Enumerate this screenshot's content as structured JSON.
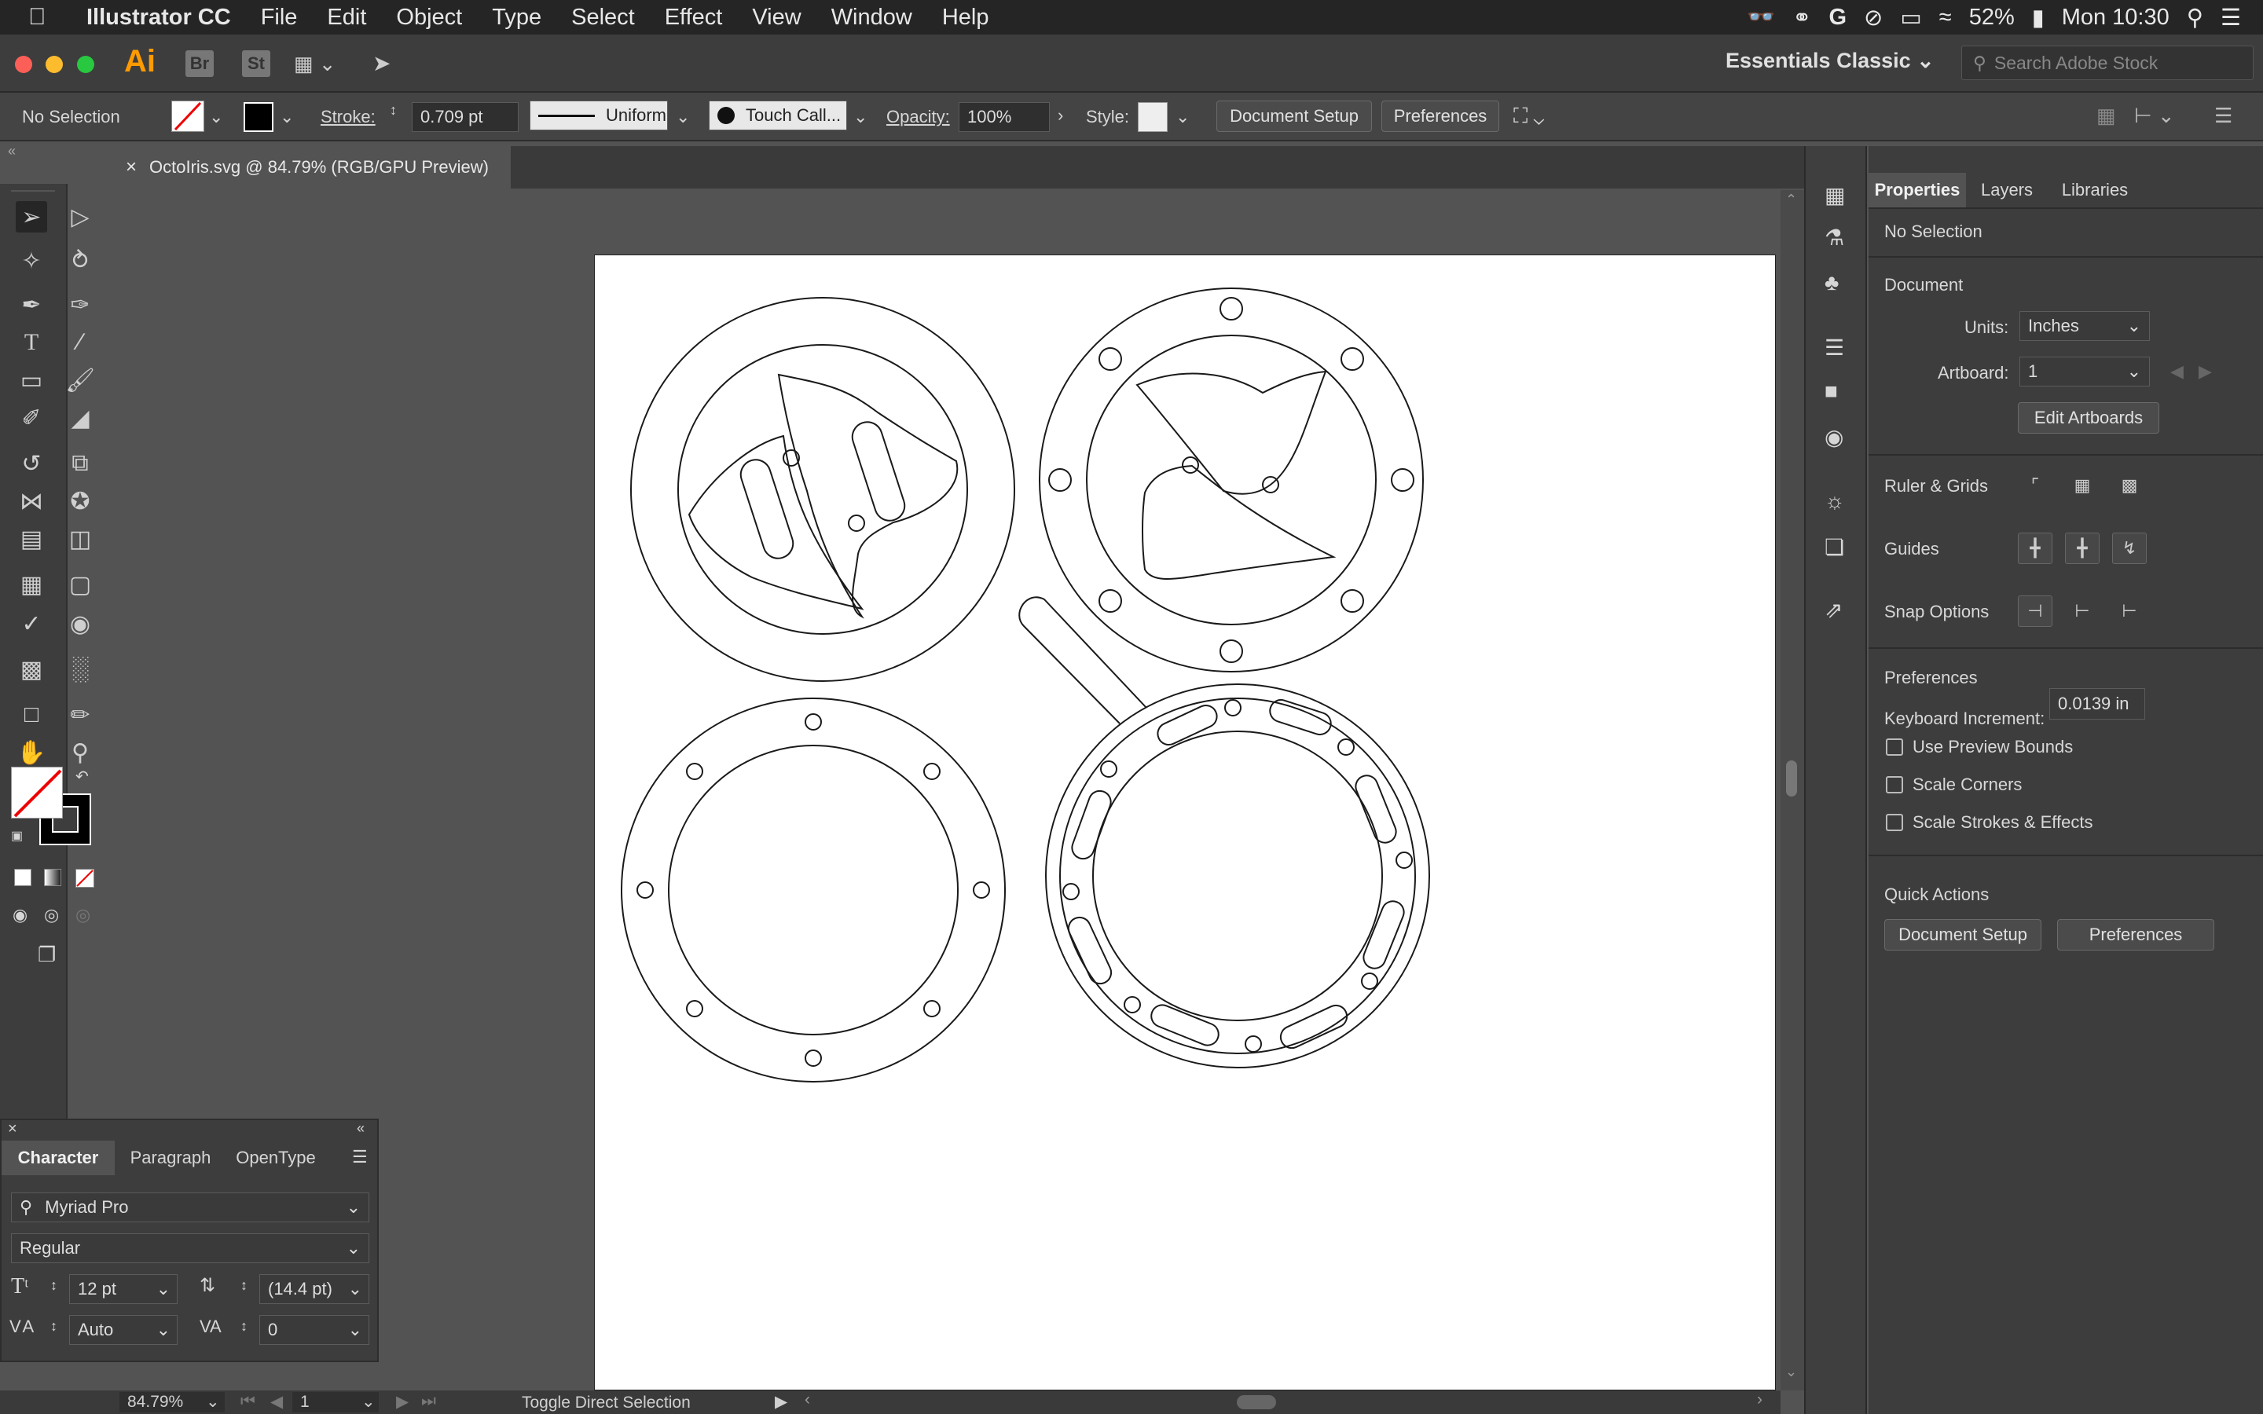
{
  "menubar": {
    "app_name": "Illustrator CC",
    "items": [
      "File",
      "Edit",
      "Object",
      "Type",
      "Select",
      "Effect",
      "View",
      "Window",
      "Help"
    ],
    "battery": "52%",
    "clock": "Mon 10:30"
  },
  "appbar": {
    "ai_logo": "Ai",
    "br_label": "Br",
    "st_label": "St",
    "workspace": "Essentials Classic",
    "search_placeholder": "Search Adobe Stock"
  },
  "control": {
    "selection_status": "No Selection",
    "stroke_label": "Stroke:",
    "stroke_value": "0.709 pt",
    "profile": "Uniform",
    "brush": "Touch Call...",
    "opacity_label": "Opacity:",
    "opacity_value": "100%",
    "style_label": "Style:",
    "doc_setup": "Document Setup",
    "preferences": "Preferences"
  },
  "document": {
    "tab_title": "OctoIris.svg @ 84.79% (RGB/GPU Preview)"
  },
  "properties": {
    "tabs": [
      "Properties",
      "Layers",
      "Libraries"
    ],
    "selection": "No Selection",
    "document_heading": "Document",
    "units_label": "Units:",
    "units_value": "Inches",
    "artboard_label": "Artboard:",
    "artboard_value": "1",
    "edit_artboards": "Edit Artboards",
    "ruler_grids": "Ruler & Grids",
    "guides": "Guides",
    "snap_options": "Snap Options",
    "prefs_heading": "Preferences",
    "keyboard_increment_label": "Keyboard Increment:",
    "keyboard_increment_value": "0.0139 in",
    "use_preview_bounds": "Use Preview Bounds",
    "scale_corners": "Scale Corners",
    "scale_strokes": "Scale Strokes & Effects",
    "quick_actions": "Quick Actions",
    "qa_doc_setup": "Document Setup",
    "qa_preferences": "Preferences"
  },
  "character": {
    "tabs": [
      "Character",
      "Paragraph",
      "OpenType"
    ],
    "font_family": "Myriad Pro",
    "font_style": "Regular",
    "font_size": "12 pt",
    "leading": "(14.4 pt)",
    "kerning": "Auto",
    "tracking": "0"
  },
  "status": {
    "zoom": "84.79%",
    "artboard_number": "1",
    "tool_hint": "Toggle Direct Selection"
  },
  "colors": {
    "panel": "#3d3d3d",
    "canvas": "#535353",
    "artboard": "#ffffff"
  }
}
